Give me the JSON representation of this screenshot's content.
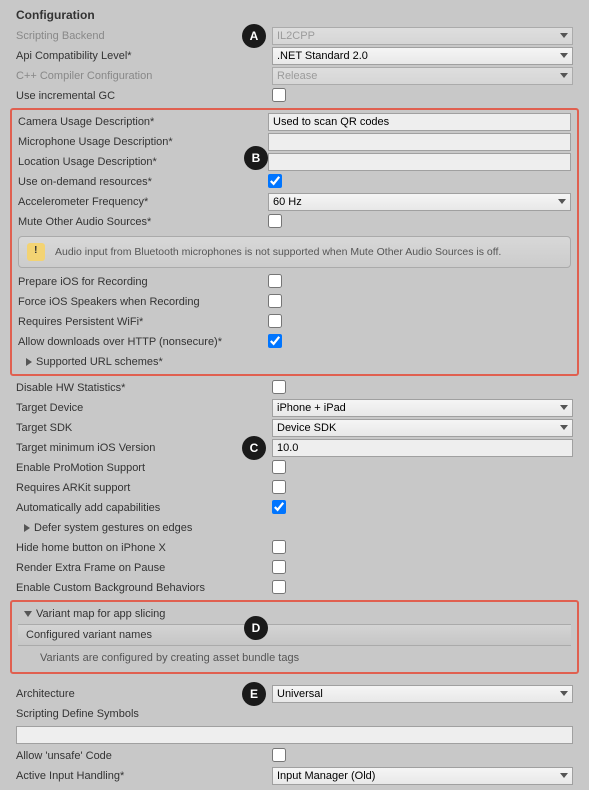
{
  "header": "Configuration",
  "r": {
    "scriptingBackend": {
      "l": "Scripting Backend",
      "v": "IL2CPP"
    },
    "apiCompat": {
      "l": "Api Compatibility Level*",
      "v": ".NET Standard 2.0"
    },
    "cppCompiler": {
      "l": "C++ Compiler Configuration",
      "v": "Release"
    },
    "incGC": {
      "l": "Use incremental GC"
    },
    "camUsage": {
      "l": "Camera Usage Description*",
      "v": "Used to scan QR codes"
    },
    "micUsage": {
      "l": "Microphone Usage Description*",
      "v": ""
    },
    "locUsage": {
      "l": "Location Usage Description*",
      "v": ""
    },
    "onDemand": {
      "l": "Use on-demand resources*"
    },
    "accel": {
      "l": "Accelerometer Frequency*",
      "v": "60 Hz"
    },
    "muteOther": {
      "l": "Mute Other Audio Sources*"
    },
    "prepRec": {
      "l": "Prepare iOS for Recording"
    },
    "forceSpk": {
      "l": "Force iOS Speakers when Recording"
    },
    "reqWifi": {
      "l": "Requires Persistent WiFi*"
    },
    "allowHttp": {
      "l": "Allow downloads over HTTP (nonsecure)*"
    },
    "urlSchemes": {
      "l": "Supported URL schemes*"
    },
    "disHW": {
      "l": "Disable HW Statistics*"
    },
    "tgtDev": {
      "l": "Target Device",
      "v": "iPhone + iPad"
    },
    "tgtSDK": {
      "l": "Target SDK",
      "v": "Device SDK"
    },
    "tgtMin": {
      "l": "Target minimum iOS Version",
      "v": "10.0"
    },
    "proMotion": {
      "l": "Enable ProMotion Support"
    },
    "arkit": {
      "l": "Requires ARKit support"
    },
    "autoCap": {
      "l": "Automatically add capabilities"
    },
    "deferGest": {
      "l": "Defer system gestures on edges"
    },
    "hideHome": {
      "l": "Hide home button on iPhone X"
    },
    "extraFrame": {
      "l": "Render Extra Frame on Pause"
    },
    "customBg": {
      "l": "Enable Custom Background Behaviors"
    },
    "variantMap": {
      "l": "Variant map for app slicing"
    },
    "confVar": {
      "l": "Configured variant names"
    },
    "varHelp": "Variants are configured by creating asset bundle tags",
    "arch": {
      "l": "Architecture",
      "v": "Universal"
    },
    "defSym": {
      "l": "Scripting Define Symbols",
      "v": ""
    },
    "unsafe": {
      "l": "Allow 'unsafe' Code"
    },
    "inputH": {
      "l": "Active Input Handling*",
      "v": "Input Manager (Old)"
    }
  },
  "infoMsg": "Audio input from Bluetooth microphones is not supported when Mute Other Audio Sources is off.",
  "ann": {
    "A": "A",
    "B": "B",
    "C": "C",
    "D": "D",
    "E": "E"
  }
}
